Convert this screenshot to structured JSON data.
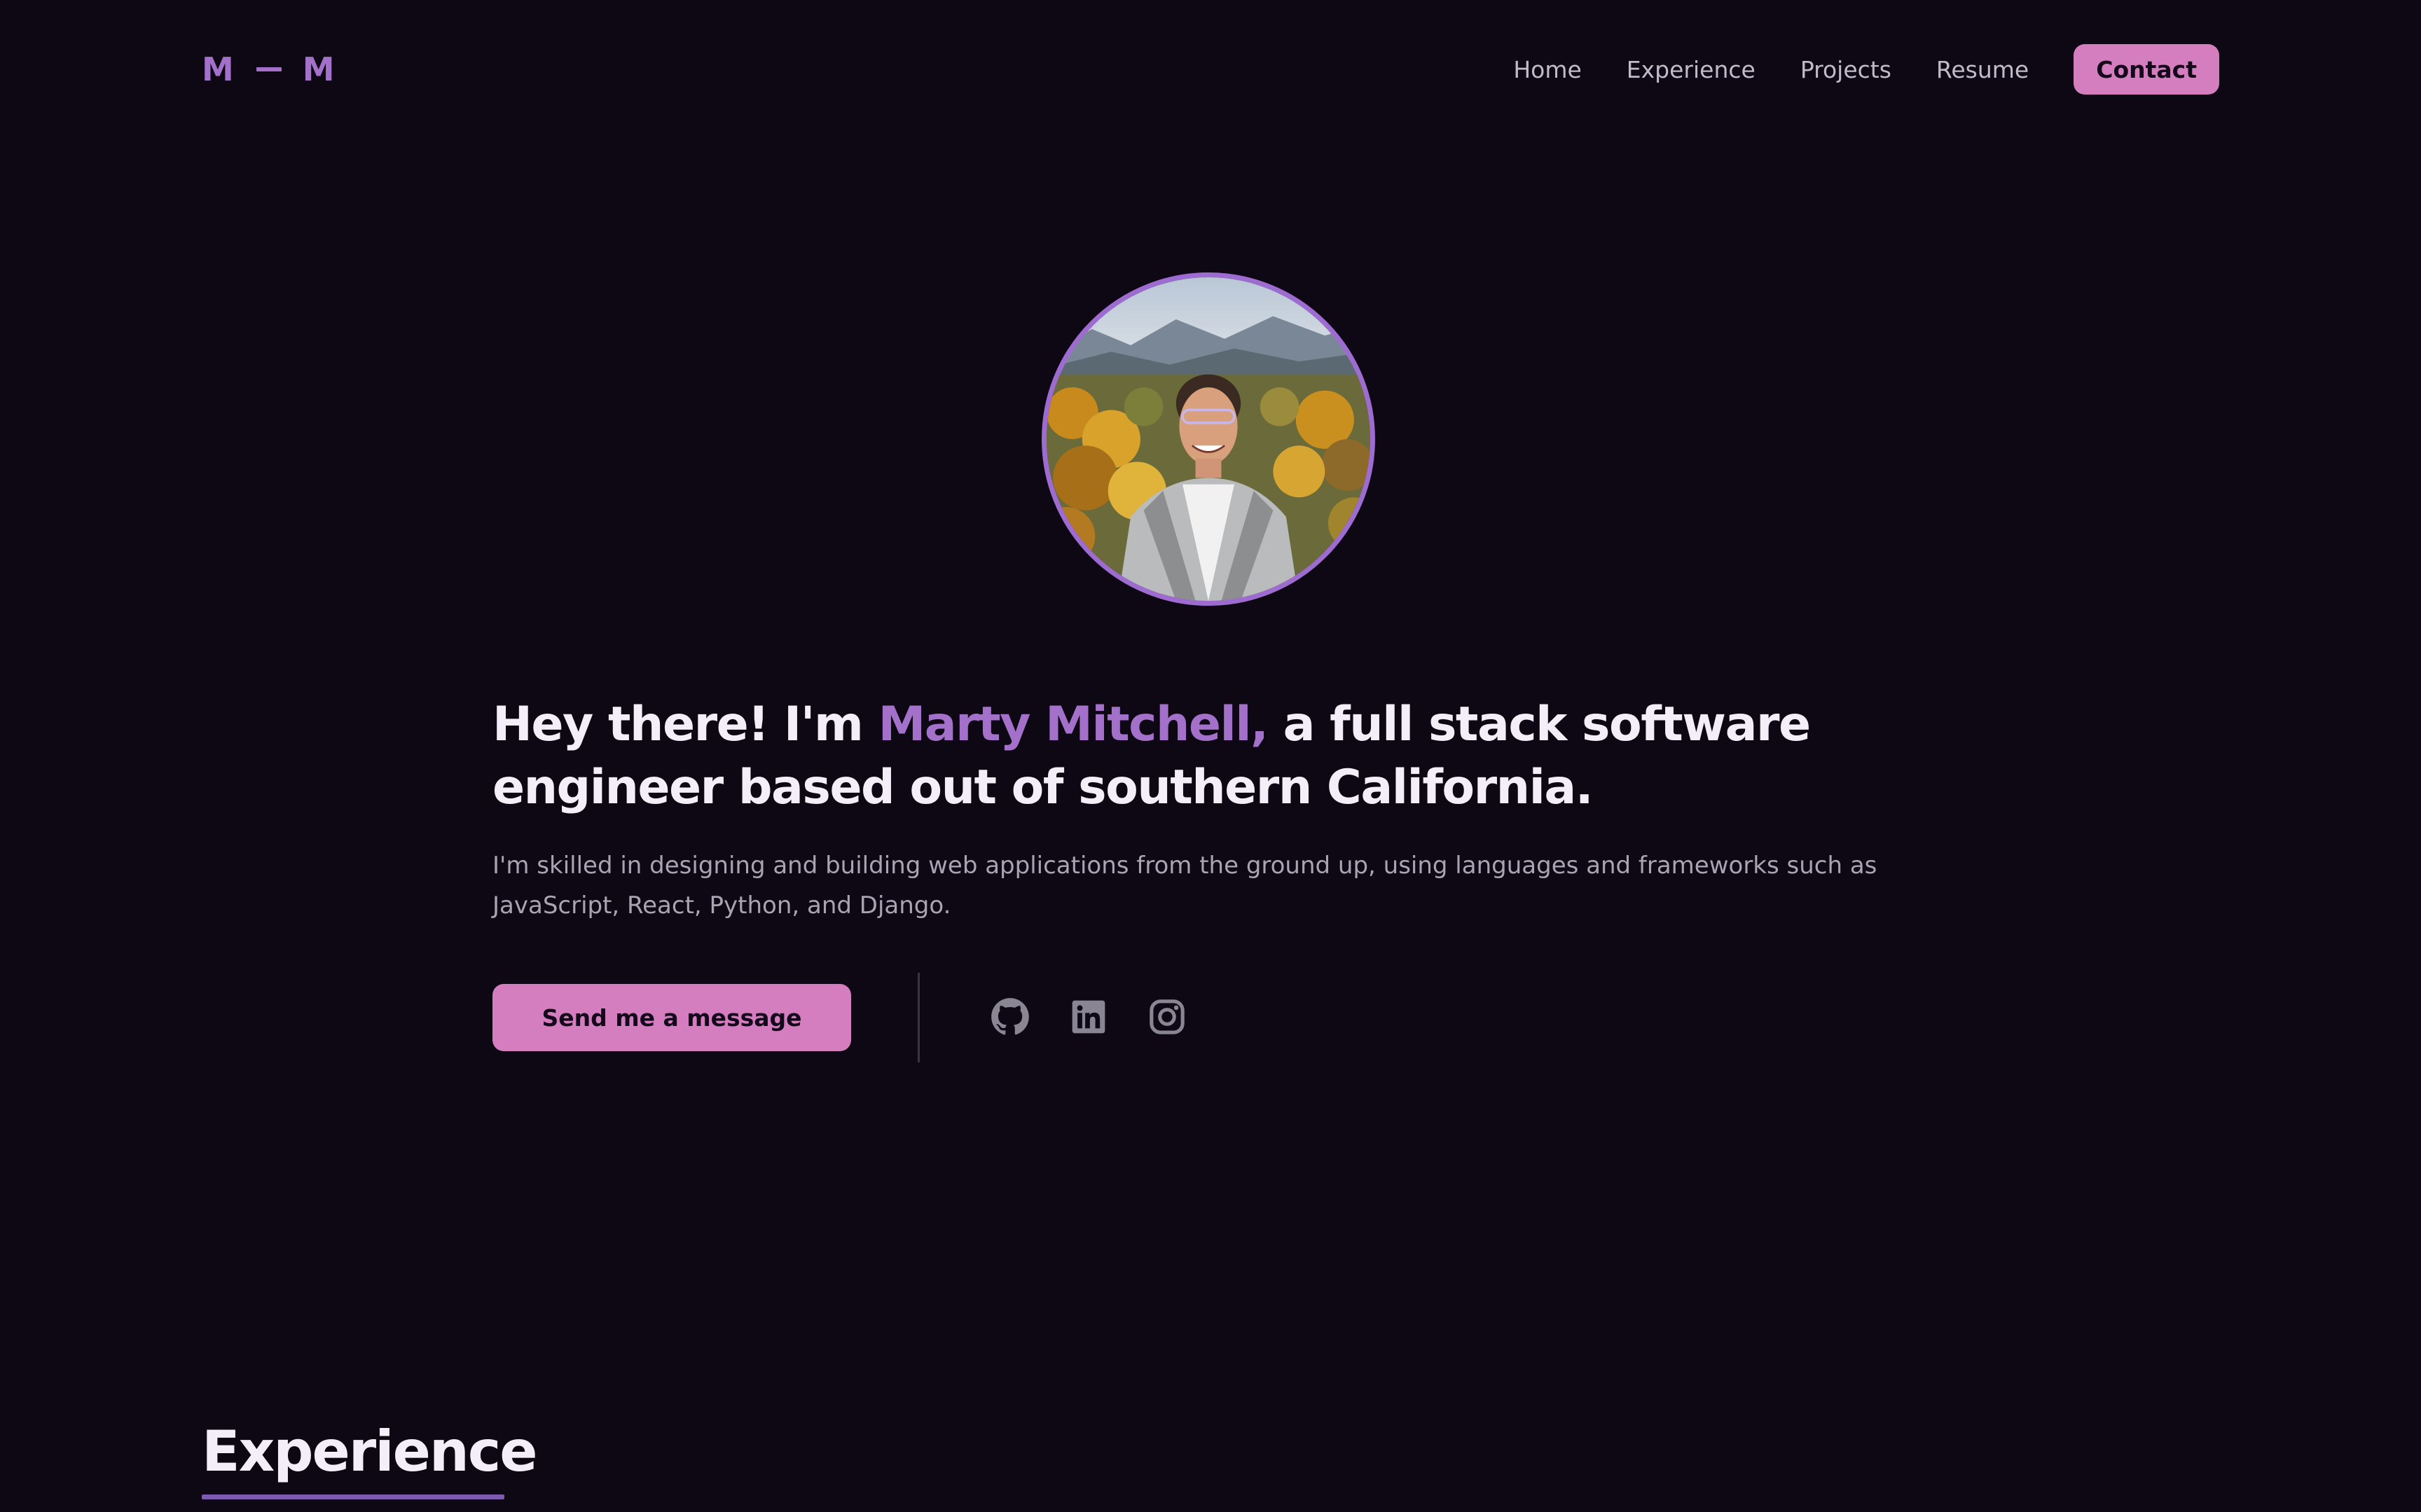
{
  "header": {
    "logo_left": "M",
    "logo_right": "M",
    "nav": {
      "home": "Home",
      "experience": "Experience",
      "projects": "Projects",
      "resume": "Resume",
      "contact": "Contact"
    }
  },
  "hero": {
    "headline_pre": "Hey there! I'm ",
    "headline_name": "Marty Mitchell,",
    "headline_post": " a full stack software engineer based out of southern California.",
    "description": "I'm skilled in designing and building web applications from the ground up, using languages and frameworks such as JavaScript, React, Python, and Django.",
    "cta_label": "Send me a message"
  },
  "social": {
    "icons": [
      "github-icon",
      "linkedin-icon",
      "instagram-icon"
    ]
  },
  "sections": {
    "experience_title": "Experience"
  },
  "colors": {
    "background": "#0d0814",
    "accent_purple": "#a371c9",
    "accent_pink": "#d47ec0",
    "text_primary": "#f3eef7",
    "text_muted": "#a9a3b2",
    "icon_gray": "#8a8593"
  }
}
